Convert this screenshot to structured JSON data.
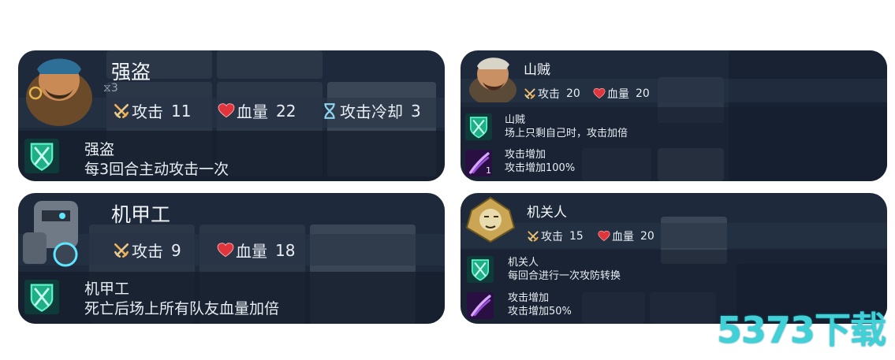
{
  "cards": [
    {
      "name": "强盗",
      "stats": [
        {
          "icon": "crossed-swords-icon",
          "label": "攻击",
          "value": "11"
        },
        {
          "icon": "heart-icon",
          "label": "血量",
          "value": "22"
        },
        {
          "icon": "hourglass-icon",
          "label": "攻击冷却",
          "value": "3"
        }
      ],
      "skills": [
        {
          "icon": "shield-crossed-icon",
          "name": "强盗",
          "desc": "每3回合主动攻击一次"
        }
      ]
    },
    {
      "name": "山贼",
      "stats": [
        {
          "icon": "crossed-swords-icon",
          "label": "攻击",
          "value": "20"
        },
        {
          "icon": "heart-icon",
          "label": "血量",
          "value": "20"
        }
      ],
      "skills": [
        {
          "icon": "shield-crossed-icon",
          "name": "山贼",
          "desc": "场上只剩自己时，攻击加倍"
        },
        {
          "icon": "purple-slash-icon",
          "name": "攻击增加",
          "desc": "攻击增加100%",
          "count": "1"
        }
      ]
    },
    {
      "name": "机甲工",
      "stats": [
        {
          "icon": "crossed-swords-icon",
          "label": "攻击",
          "value": "9"
        },
        {
          "icon": "heart-icon",
          "label": "血量",
          "value": "18"
        }
      ],
      "skills": [
        {
          "icon": "shield-crossed-icon",
          "name": "机甲工",
          "desc": "死亡后场上所有队友血量加倍"
        }
      ]
    },
    {
      "name": "机关人",
      "stats": [
        {
          "icon": "crossed-swords-icon",
          "label": "攻击",
          "value": "15"
        },
        {
          "icon": "heart-icon",
          "label": "血量",
          "value": "20"
        }
      ],
      "skills": [
        {
          "icon": "shield-crossed-icon",
          "name": "机关人",
          "desc": "每回合进行一次攻防转换"
        },
        {
          "icon": "purple-slash-icon",
          "name": "攻击增加",
          "desc": "攻击增加50%"
        }
      ]
    }
  ],
  "watermark": "5373下载",
  "colors": {
    "card_bg": "#1e2a3c",
    "heart": "#e0353d",
    "skill_green": "#2fd7a3",
    "skill_purple": "#9b4fe0",
    "watermark": "#3fd1d6"
  }
}
